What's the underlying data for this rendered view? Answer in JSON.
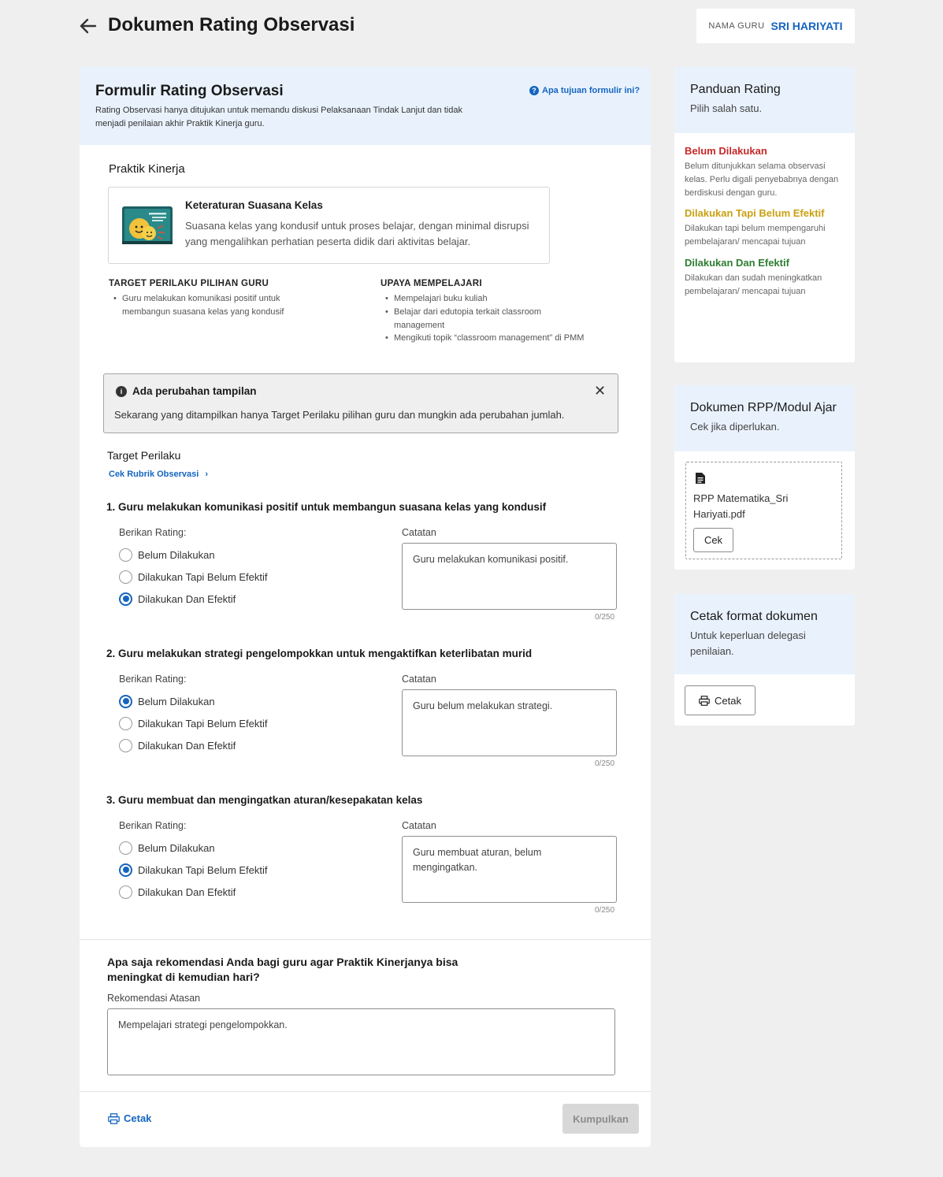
{
  "header": {
    "title": "Dokumen Rating Observasi",
    "teacher_label": "NAMA GURU",
    "teacher_name": "SRI HARIYATI"
  },
  "form": {
    "title": "Formulir Rating Observasi",
    "description": "Rating Observasi hanya ditujukan untuk memandu diskusi Pelaksanaan Tindak Lanjut dan tidak menjadi penilaian akhir Praktik Kinerja guru.",
    "help_link": "Apa tujuan formulir ini?",
    "section_title": "Praktik Kinerja",
    "practice": {
      "name": "Keteraturan Suasana Kelas",
      "description": "Suasana kelas yang kondusif untuk proses belajar, dengan minimal disrupsi yang mengalihkan perhatian peserta didik dari aktivitas belajar."
    },
    "target_heading": "TARGET PERILAKU PILIHAN GURU",
    "target_items": [
      "Guru melakukan komunikasi positif untuk membangun suasana kelas yang kondusif"
    ],
    "effort_heading": "UPAYA MEMPELAJARI",
    "effort_items": [
      "Mempelajari buku kuliah",
      "Belajar dari edutopia terkait classroom management",
      "Mengikuti topik “classroom management” di PMM"
    ],
    "notice": {
      "title": "Ada perubahan tampilan",
      "body": "Sekarang yang ditampilkan hanya Target Perilaku pilihan guru dan mungkin ada perubahan jumlah.",
      "close": "✕"
    },
    "target_title": "Target Perilaku",
    "rubric_link": "Cek Rubrik Observasi",
    "rubric_chevron": "›",
    "rating_label": "Berikan Rating:",
    "notes_label": "Catatan",
    "options": [
      "Belum Dilakukan",
      "Dilakukan Tapi Belum Efektif",
      "Dilakukan Dan Efektif"
    ],
    "questions": [
      {
        "title": "1. Guru melakukan komunikasi positif untuk membangun suasana kelas yang kondusif",
        "selected": 2,
        "note": "Guru melakukan komunikasi positif.",
        "count": "0/250"
      },
      {
        "title": "2. Guru melakukan strategi pengelompokkan untuk mengaktifkan keterlibatan murid",
        "selected": 0,
        "note": "Guru belum melakukan strategi.",
        "count": "0/250"
      },
      {
        "title": "3. Guru membuat dan mengingatkan aturan/kesepakatan kelas",
        "selected": 1,
        "note": "Guru membuat aturan, belum mengingatkan.",
        "count": "0/250"
      }
    ],
    "recommendation": {
      "question": "Apa saja rekomendasi Anda bagi guru agar Praktik Kinerjanya bisa meningkat di kemudian hari?",
      "label": "Rekomendasi Atasan",
      "value": "Mempelajari strategi pengelompokkan."
    },
    "print_label": "Cetak",
    "submit_label": "Kumpulkan"
  },
  "guide": {
    "title": "Panduan Rating",
    "subtitle": "Pilih salah satu.",
    "items": [
      {
        "title": "Belum Dilakukan",
        "desc": "Belum ditunjukkan selama observasi kelas. Perlu digali penyebabnya dengan berdiskusi dengan guru.",
        "color": "#c62828"
      },
      {
        "title": "Dilakukan Tapi Belum Efektif",
        "desc": "Dilakukan tapi belum mempengaruhi pembelajaran/ mencapai tujuan",
        "color": "#c9a012"
      },
      {
        "title": "Dilakukan Dan Efektif",
        "desc": "Dilakukan dan sudah meningkatkan pembelajaran/ mencapai tujuan",
        "color": "#2e7d32"
      }
    ]
  },
  "rpp": {
    "title": "Dokumen RPP/Modul Ajar",
    "subtitle": "Cek jika diperlukan.",
    "file_name": "RPP Matematika_Sri Hariyati.pdf",
    "button": "Cek"
  },
  "print_card": {
    "title": "Cetak format dokumen",
    "subtitle": "Untuk keperluan delegasi penilaian.",
    "button": "Cetak"
  },
  "colors": {
    "accent": "#1565c0",
    "header_bg": "#e9f2fc",
    "page_bg": "#efefef"
  }
}
